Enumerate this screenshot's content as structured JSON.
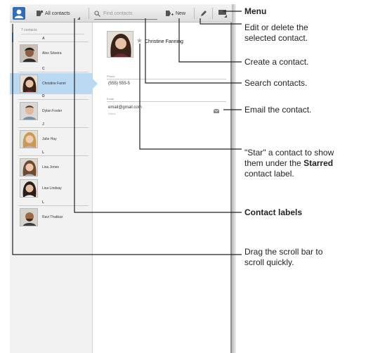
{
  "toolbar": {
    "labels_dropdown": "All contacts",
    "search_placeholder": "Find contacts",
    "new_label": "New"
  },
  "contact_list": {
    "count": "7 contacts",
    "rows": [
      {
        "kind": "section",
        "letter": "A"
      },
      {
        "kind": "contact",
        "name": "Alex Silveira"
      },
      {
        "kind": "section",
        "letter": "C"
      },
      {
        "kind": "contact",
        "name": "Christine Fanni",
        "selected": true
      },
      {
        "kind": "section",
        "letter": "D"
      },
      {
        "kind": "contact",
        "name": "Dylan Foster"
      },
      {
        "kind": "section",
        "letter": "J"
      },
      {
        "kind": "contact",
        "name": "Julie Hay"
      },
      {
        "kind": "section",
        "letter": "L"
      },
      {
        "kind": "contact",
        "name": "Lisa Jones"
      },
      {
        "kind": "contact",
        "name": "Lisa Lindsay"
      },
      {
        "kind": "section",
        "letter": "L"
      },
      {
        "kind": "contact",
        "name": "Ravi Thakkar"
      }
    ]
  },
  "detail": {
    "name": "Christine Fanning",
    "phone_label": "Phone",
    "phone_value": "(555) 555-5",
    "email_label": "Email",
    "email_value": "email@gmail.com",
    "email_type": "Home"
  },
  "callouts": {
    "menu": "Menu",
    "edit_delete_line1": "Edit or delete the",
    "edit_delete_line2": "selected contact.",
    "create": "Create a contact.",
    "search": "Search contacts.",
    "email": "Email the contact.",
    "star_line1": "\"Star\" a contact to show",
    "star_line2_pre": "them under the ",
    "star_line2_bold": "Starred",
    "star_line3": "contact label.",
    "contact_labels": "Contact labels",
    "scroll_line1": "Drag the scroll bar to",
    "scroll_line2": "scroll quickly."
  },
  "colors": {
    "accent": "#33b5e5",
    "app_icon": "#2f6db6",
    "selected_row": "#b9d8f2",
    "callout_line": "#222222"
  }
}
